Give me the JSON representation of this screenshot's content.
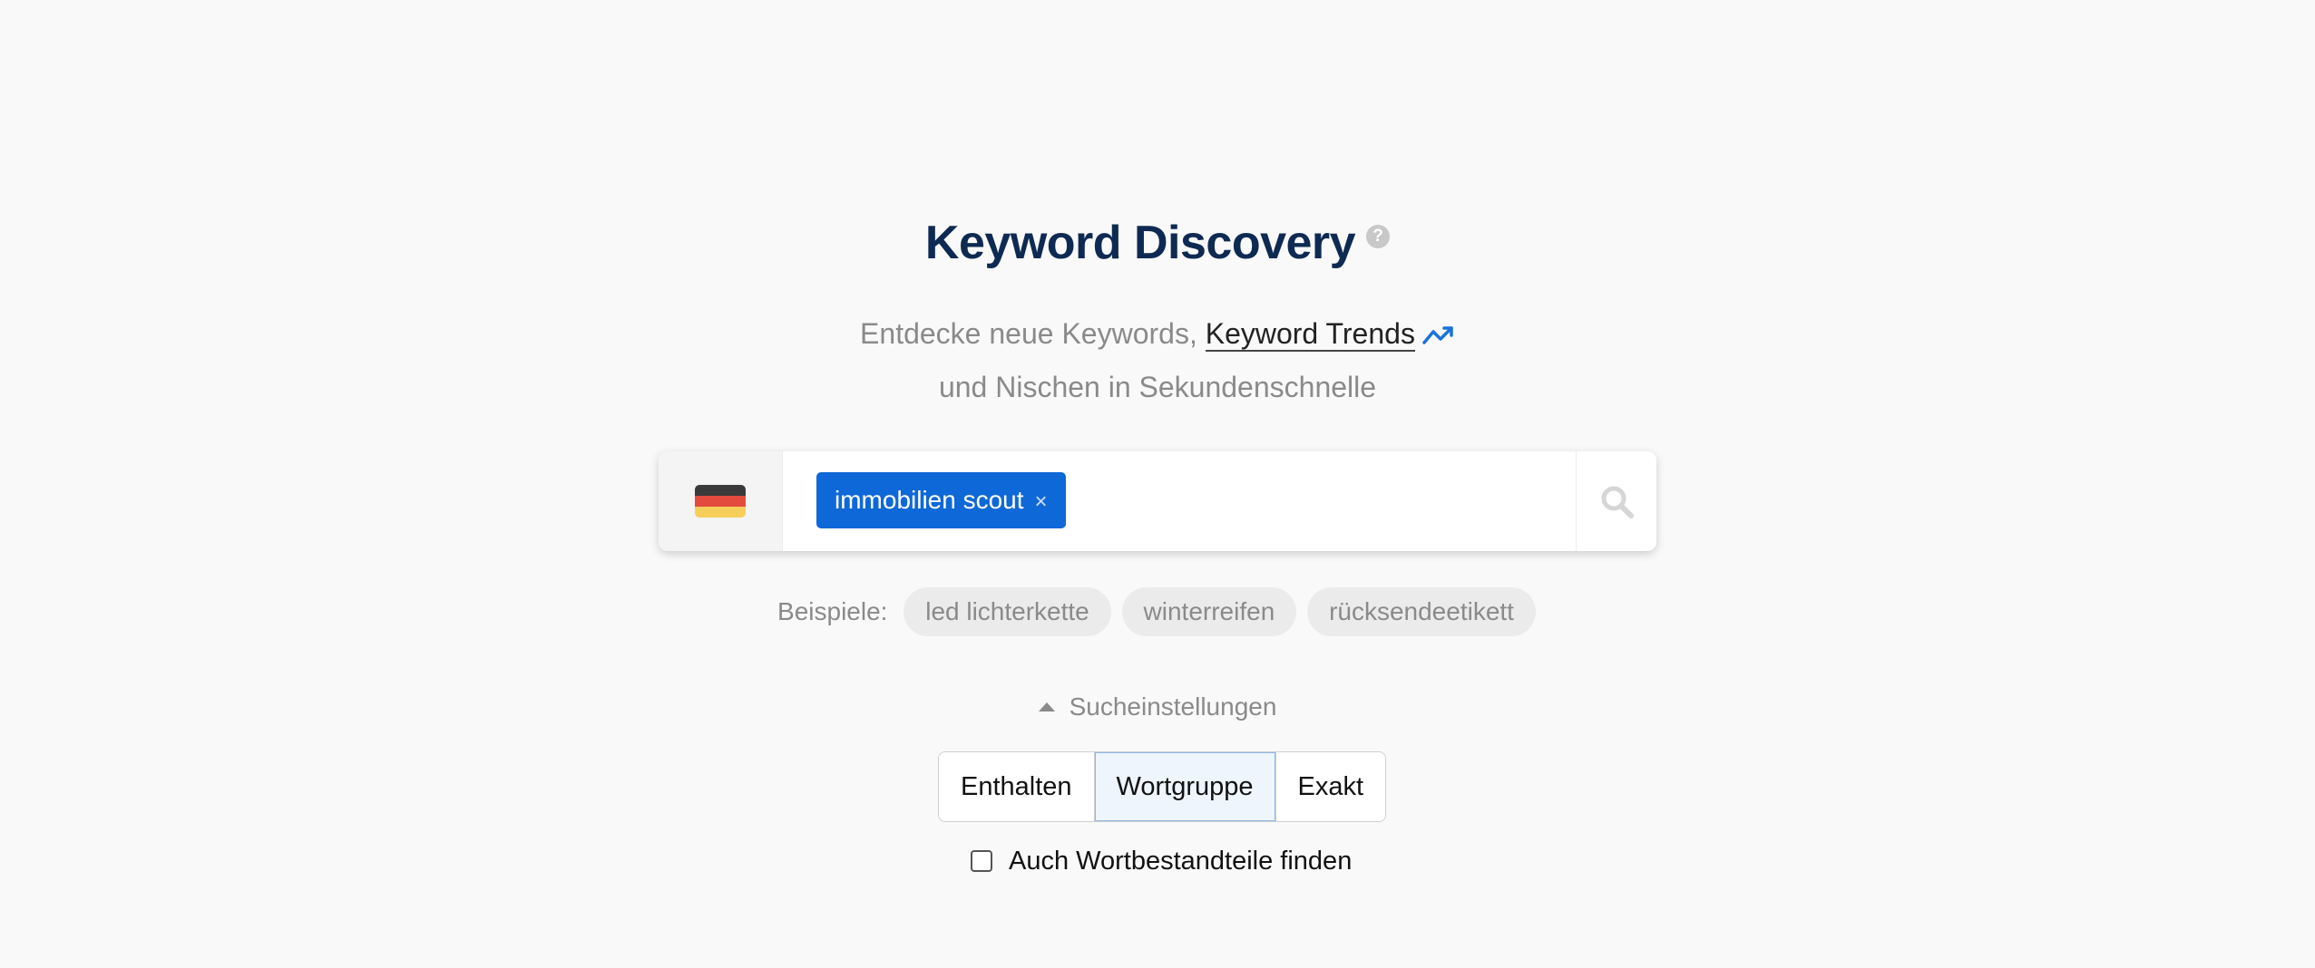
{
  "header": {
    "title": "Keyword Discovery",
    "help_icon": "question-circle-icon",
    "subtitle_part1": "Entdecke neue Keywords, ",
    "trend_link": "Keyword Trends",
    "trend_icon": "trending-up-icon",
    "subtitle_line2": "und Nischen in Sekundenschnelle"
  },
  "search": {
    "country_flag": "germany-flag-icon",
    "flag_colors": [
      "#3a3a3a",
      "#e34b3f",
      "#f6cf5a"
    ],
    "tag_label": "immobilien scout",
    "tag_remove": "×",
    "search_icon": "search-icon"
  },
  "examples": {
    "label": "Beispiele:",
    "items": [
      "led lichterkette",
      "winterreifen",
      "rücksendeetikett"
    ]
  },
  "settings": {
    "toggle_label": "Sucheinstellungen",
    "match_options": [
      "Enthalten",
      "Wortgruppe",
      "Exakt"
    ],
    "selected_option": "Wortgruppe",
    "checkbox_label": "Auch Wortbestandteile finden",
    "checkbox_checked": false
  },
  "colors": {
    "title": "#0e2a52",
    "accent": "#0f68d7",
    "muted_text": "#8a8a8a",
    "background": "#f9f9f9"
  }
}
